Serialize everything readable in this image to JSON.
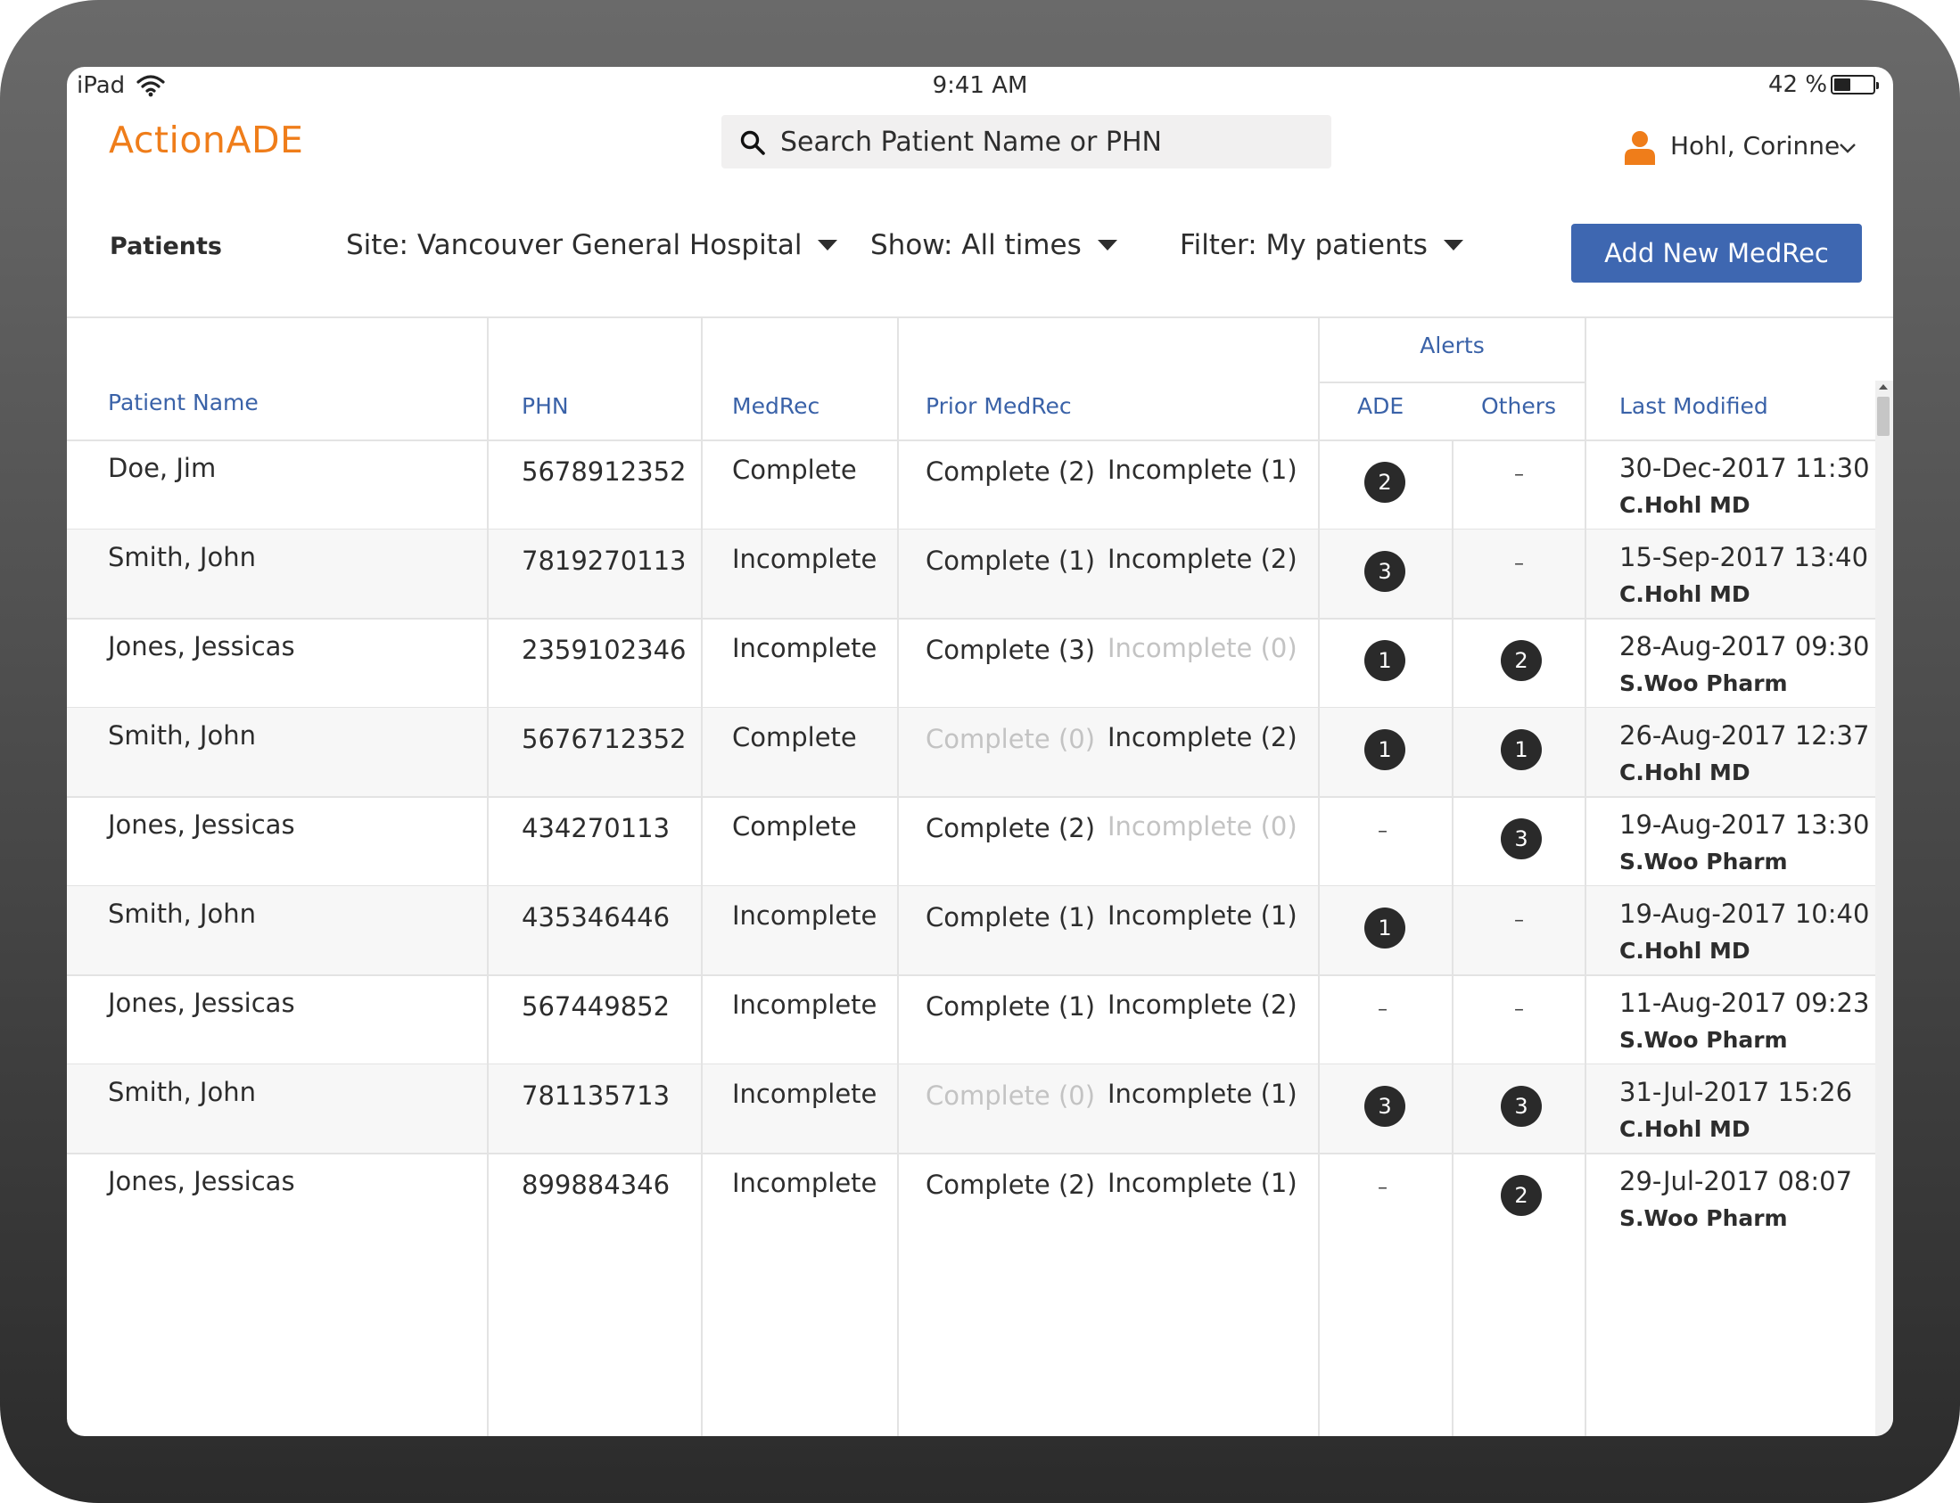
{
  "status_bar": {
    "carrier": "iPad",
    "time": "9:41 AM",
    "battery": "42 %",
    "battery_level": 0.42
  },
  "app": {
    "title": "ActionADE"
  },
  "search": {
    "placeholder": "Search Patient Name or PHN"
  },
  "user": {
    "name": "Hohl, Corinne"
  },
  "toolbar": {
    "label": "Patients",
    "site": "Site: Vancouver General Hospital",
    "show": "Show: All times",
    "filter": "Filter: My patients",
    "add_button": "Add New MedRec"
  },
  "table": {
    "headers": {
      "patient_name": "Patient Name",
      "phn": "PHN",
      "medrec": "MedRec",
      "prior_medrec": "Prior MedRec",
      "alerts": "Alerts",
      "ade": "ADE",
      "others": "Others",
      "last_modified": "Last Modified"
    },
    "dash": "–",
    "rows": [
      {
        "name": "Doe, Jim",
        "phn": "5678912352",
        "medrec": "Complete",
        "prior_complete": "Complete (2)",
        "prior_incomplete": "Incomplete (1)",
        "ade": "2",
        "others": "",
        "date": "30-Dec-2017 11:30",
        "by": "C.Hohl MD"
      },
      {
        "name": "Smith, John",
        "phn": "7819270113",
        "medrec": "Incomplete",
        "prior_complete": "Complete (1)",
        "prior_incomplete": "Incomplete (2)",
        "ade": "3",
        "others": "",
        "date": "15-Sep-2017 13:40",
        "by": "C.Hohl MD"
      },
      {
        "name": "Jones, Jessicas",
        "phn": "2359102346",
        "medrec": "Incomplete",
        "prior_complete": "Complete (3)",
        "prior_incomplete": "Incomplete (0)",
        "ade": "1",
        "others": "2",
        "date": "28-Aug-2017 09:30",
        "by": "S.Woo Pharm"
      },
      {
        "name": "Smith, John",
        "phn": "5676712352",
        "medrec": "Complete",
        "prior_complete": "Complete (0)",
        "prior_incomplete": "Incomplete (2)",
        "ade": "1",
        "others": "1",
        "date": "26-Aug-2017 12:37",
        "by": "C.Hohl MD"
      },
      {
        "name": "Jones, Jessicas",
        "phn": "434270113",
        "medrec": "Complete",
        "prior_complete": "Complete (2)",
        "prior_incomplete": "Incomplete (0)",
        "ade": "",
        "others": "3",
        "date": "19-Aug-2017 13:30",
        "by": "S.Woo Pharm"
      },
      {
        "name": "Smith, John",
        "phn": "435346446",
        "medrec": "Incomplete",
        "prior_complete": "Complete (1)",
        "prior_incomplete": "Incomplete (1)",
        "ade": "1",
        "others": "",
        "date": "19-Aug-2017 10:40",
        "by": "C.Hohl MD"
      },
      {
        "name": "Jones, Jessicas",
        "phn": "567449852",
        "medrec": "Incomplete",
        "prior_complete": "Complete (1)",
        "prior_incomplete": "Incomplete (2)",
        "ade": "",
        "others": "",
        "date": "11-Aug-2017 09:23",
        "by": "S.Woo Pharm"
      },
      {
        "name": "Smith, John",
        "phn": "781135713",
        "medrec": "Incomplete",
        "prior_complete": "Complete (0)",
        "prior_incomplete": "Incomplete (1)",
        "ade": "3",
        "others": "3",
        "date": "31-Jul-2017 15:26",
        "by": "C.Hohl MD"
      },
      {
        "name": "Jones, Jessicas",
        "phn": "899884346",
        "medrec": "Incomplete",
        "prior_complete": "Complete (2)",
        "prior_incomplete": "Incomplete (1)",
        "ade": "",
        "others": "2",
        "date": "29-Jul-2017 08:07",
        "by": "S.Woo Pharm"
      }
    ]
  },
  "colors": {
    "brand": "#ef7d1a",
    "accent": "#3e67b1",
    "header_text": "#3a62a8",
    "muted": "#c3c3c3",
    "badge": "#2a2a2a"
  }
}
